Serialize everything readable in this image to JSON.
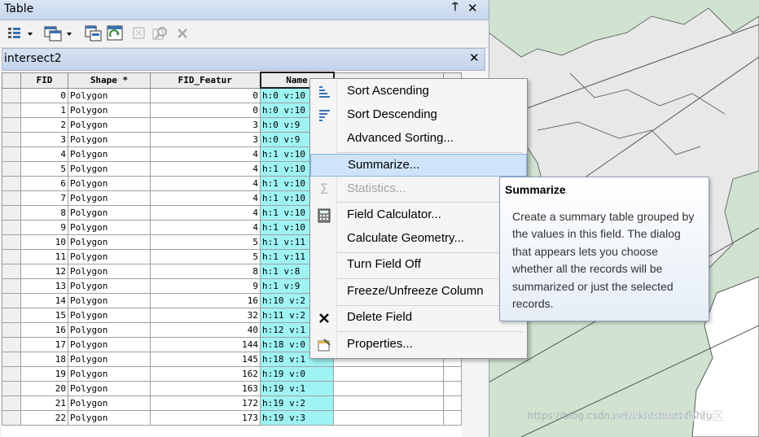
{
  "window": {
    "title": "Table",
    "pin_glyph": "⍑",
    "close_glyph": "✕"
  },
  "toolbar": {
    "buttons": [
      {
        "name": "table-options-icon"
      },
      {
        "name": "related-tables-icon"
      },
      {
        "name": "select-by-attributes-icon"
      },
      {
        "name": "switch-selection-icon"
      },
      {
        "name": "clear-selection-icon"
      },
      {
        "name": "zoom-to-selected-icon"
      },
      {
        "name": "delete-selected-icon"
      }
    ]
  },
  "tab": {
    "label": "intersect2",
    "close_glyph": "✕"
  },
  "grid": {
    "columns": [
      "FID",
      "Shape *",
      "FID_Featur",
      "Name"
    ],
    "rows": [
      {
        "fid": "0",
        "shape": "Polygon",
        "fid_featur": "0",
        "name": "h:0 v:10"
      },
      {
        "fid": "1",
        "shape": "Polygon",
        "fid_featur": "0",
        "name": "h:0 v:10"
      },
      {
        "fid": "2",
        "shape": "Polygon",
        "fid_featur": "3",
        "name": "h:0 v:9"
      },
      {
        "fid": "3",
        "shape": "Polygon",
        "fid_featur": "3",
        "name": "h:0 v:9"
      },
      {
        "fid": "4",
        "shape": "Polygon",
        "fid_featur": "4",
        "name": "h:1 v:10"
      },
      {
        "fid": "5",
        "shape": "Polygon",
        "fid_featur": "4",
        "name": "h:1 v:10"
      },
      {
        "fid": "6",
        "shape": "Polygon",
        "fid_featur": "4",
        "name": "h:1 v:10"
      },
      {
        "fid": "7",
        "shape": "Polygon",
        "fid_featur": "4",
        "name": "h:1 v:10"
      },
      {
        "fid": "8",
        "shape": "Polygon",
        "fid_featur": "4",
        "name": "h:1 v:10"
      },
      {
        "fid": "9",
        "shape": "Polygon",
        "fid_featur": "4",
        "name": "h:1 v:10"
      },
      {
        "fid": "10",
        "shape": "Polygon",
        "fid_featur": "5",
        "name": "h:1 v:11"
      },
      {
        "fid": "11",
        "shape": "Polygon",
        "fid_featur": "5",
        "name": "h:1 v:11"
      },
      {
        "fid": "12",
        "shape": "Polygon",
        "fid_featur": "8",
        "name": "h:1 v:8"
      },
      {
        "fid": "13",
        "shape": "Polygon",
        "fid_featur": "9",
        "name": "h:1 v:9"
      },
      {
        "fid": "14",
        "shape": "Polygon",
        "fid_featur": "16",
        "name": "h:10 v:2"
      },
      {
        "fid": "15",
        "shape": "Polygon",
        "fid_featur": "32",
        "name": "h:11 v:2"
      },
      {
        "fid": "16",
        "shape": "Polygon",
        "fid_featur": "40",
        "name": "h:12 v:1"
      },
      {
        "fid": "17",
        "shape": "Polygon",
        "fid_featur": "144",
        "name": "h:18 v:0"
      },
      {
        "fid": "18",
        "shape": "Polygon",
        "fid_featur": "145",
        "name": "h:18 v:1"
      },
      {
        "fid": "19",
        "shape": "Polygon",
        "fid_featur": "162",
        "name": "h:19 v:0"
      },
      {
        "fid": "20",
        "shape": "Polygon",
        "fid_featur": "163",
        "name": "h:19 v:1"
      },
      {
        "fid": "21",
        "shape": "Polygon",
        "fid_featur": "172",
        "name": "h:19 v:2"
      },
      {
        "fid": "22",
        "shape": "Polygon",
        "fid_featur": "173",
        "name": "h:19 v:3"
      }
    ]
  },
  "context_menu": {
    "items": [
      {
        "label": "Sort Ascending",
        "icon": "sort-ascending-icon"
      },
      {
        "label": "Sort Descending",
        "icon": "sort-descending-icon"
      },
      {
        "label": "Advanced Sorting...",
        "icon": ""
      },
      {
        "label": "Summarize...",
        "icon": "",
        "highlighted": true
      },
      {
        "label": "Statistics...",
        "icon": "sigma-icon",
        "disabled": true
      },
      {
        "label": "Field Calculator...",
        "icon": "calculator-icon"
      },
      {
        "label": "Calculate Geometry...",
        "icon": ""
      },
      {
        "label": "Turn Field Off",
        "icon": ""
      },
      {
        "label": "Freeze/Unfreeze Column",
        "icon": ""
      },
      {
        "label": "Delete Field",
        "icon": "delete-x-icon"
      },
      {
        "label": "Properties...",
        "icon": "properties-icon"
      }
    ]
  },
  "tooltip": {
    "title": "Summarize",
    "body": "Create a summary table grouped by the values in this field. The dialog that appears lets you choose whether all the records will be summarized or just the selected records."
  },
  "watermark": {
    "url": "https://blog.csdn.net/hkhfshtbtbflshfu",
    "handle": "@稀土掘金技术社区"
  },
  "colors": {
    "map_background": "#cfe3d0",
    "highlight_cyan": "#9ff3f3",
    "menu_highlight": "#cfe4fa"
  }
}
